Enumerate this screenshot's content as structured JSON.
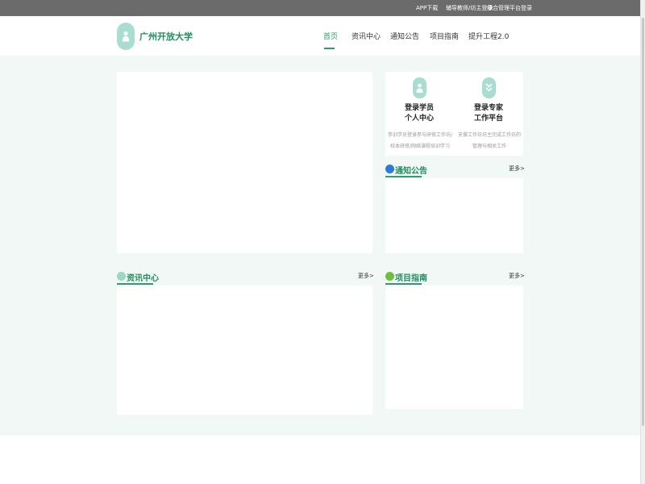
{
  "topbar": {
    "links": [
      "APP下载",
      "辅导教师/坊主登录",
      "综合管理平台登录"
    ]
  },
  "header": {
    "logo_text": "广州开放大学",
    "nav": [
      "首页",
      "资讯中心",
      "通知公告",
      "项目指南",
      "提升工程2.0"
    ],
    "active_index": 0
  },
  "login": [
    {
      "title_line1": "登录学员",
      "title_line2": "个人中心",
      "desc": "参训学员登录参与研修工作坊/校本研修/网络课程培训学习"
    },
    {
      "title_line1": "登录专家",
      "title_line2": "工作平台",
      "desc": "支撑工作坊坊主完成工作坊的管理与相关工作"
    }
  ],
  "sections": {
    "notice": {
      "title": "通知公告",
      "more": "更多>"
    },
    "news": {
      "title": "资讯中心",
      "more": "更多>"
    },
    "guide": {
      "title": "项目指南",
      "more": "更多>"
    }
  },
  "colors": {
    "accent": "#2f9c6a",
    "brand_text": "#1f8f5f",
    "topbar": "#6b6b6b",
    "mint": "#a9ddd1",
    "page_bg": "#f2f8f6"
  }
}
